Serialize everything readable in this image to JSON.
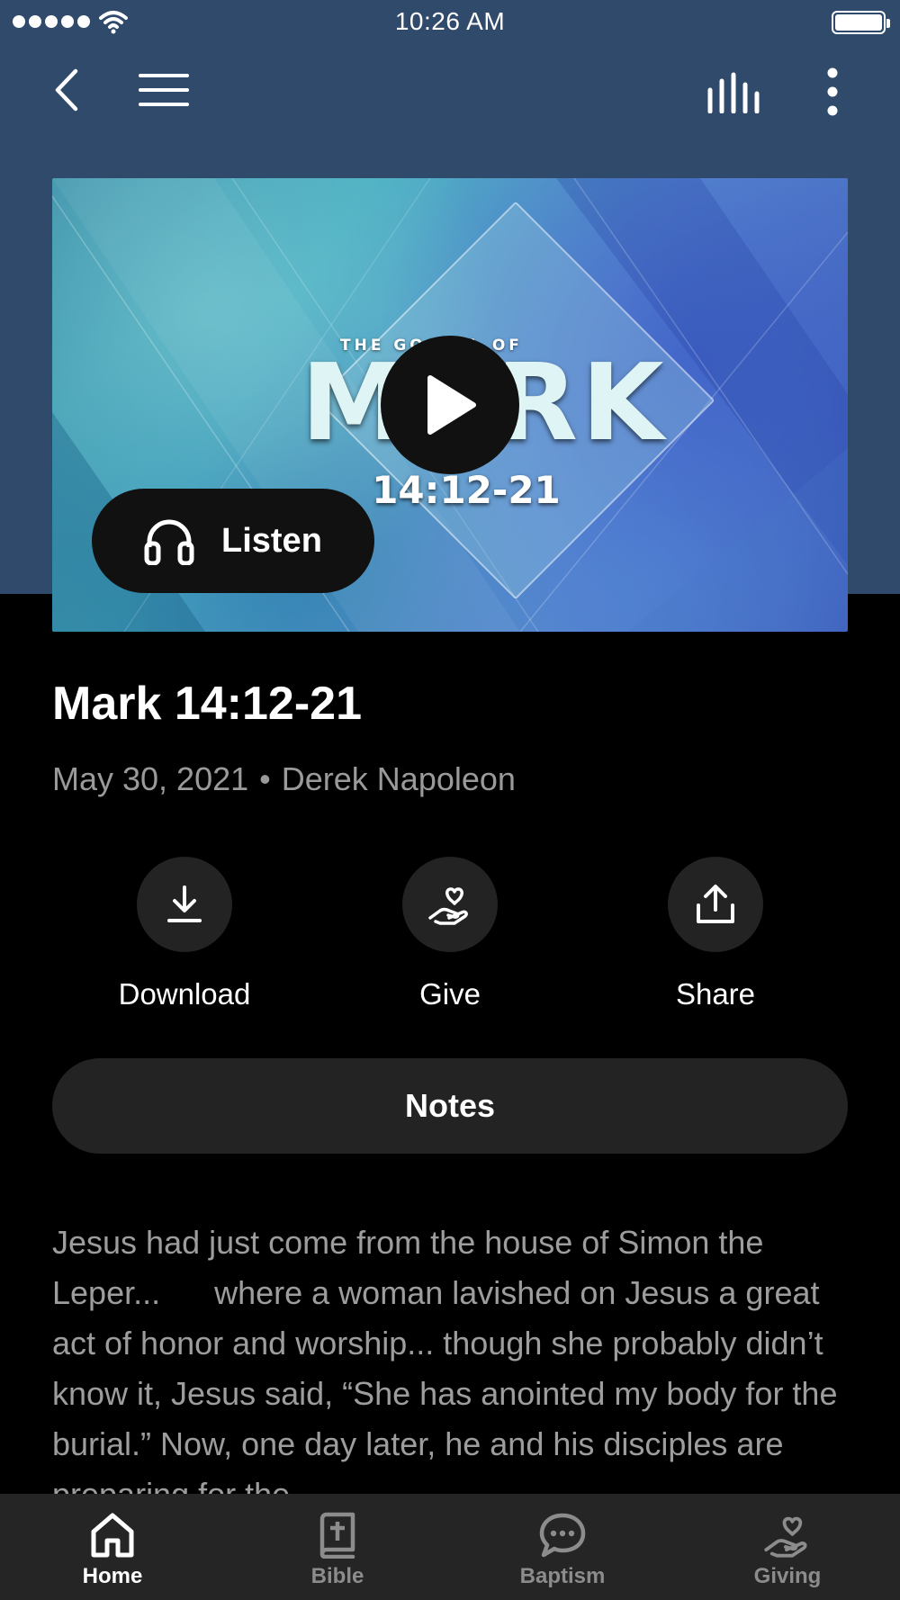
{
  "status_bar": {
    "time": "10:26 AM"
  },
  "artwork": {
    "subtitle": "THE GOSPEL OF",
    "title": "MARK",
    "reference": "14:12-21",
    "listen_label": "Listen"
  },
  "sermon": {
    "title": "Mark 14:12-21",
    "date": "May 30, 2021",
    "separator": "•",
    "speaker": "Derek Napoleon"
  },
  "actions": {
    "download_label": "Download",
    "give_label": "Give",
    "share_label": "Share"
  },
  "notes_label": "Notes",
  "description": "Jesus had just come from the house of Simon the Leper...      where a woman lavished on Jesus a great act of honor and worship... though she probably didn’t know it, Jesus said, “She has anointed my body for the burial.” Now, one day later, he and his disciples are preparing for the",
  "tabs": [
    {
      "label": "Home",
      "icon": "home-icon",
      "active": true
    },
    {
      "label": "Bible",
      "icon": "bible-icon",
      "active": false
    },
    {
      "label": "Baptism",
      "icon": "chat-icon",
      "active": false
    },
    {
      "label": "Giving",
      "icon": "giving-icon",
      "active": false
    }
  ],
  "colors": {
    "header_bg": "#2f4a6b",
    "background": "#000000",
    "surface": "#232323",
    "muted_text": "#9d9d9d"
  }
}
